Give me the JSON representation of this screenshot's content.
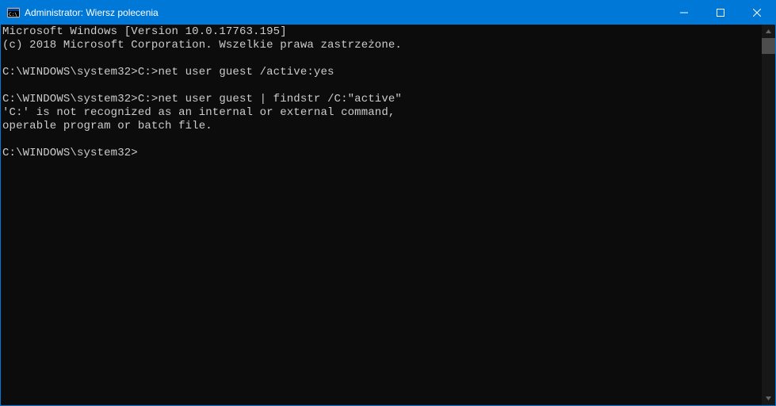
{
  "window": {
    "title": "Administrator: Wiersz polecenia"
  },
  "console": {
    "lines": [
      "Microsoft Windows [Version 10.0.17763.195]",
      "(c) 2018 Microsoft Corporation. Wszelkie prawa zastrzeżone.",
      "",
      "C:\\WINDOWS\\system32>C:>net user guest /active:yes",
      "",
      "C:\\WINDOWS\\system32>C:>net user guest | findstr /C:\"active\"",
      "'C:' is not recognized as an internal or external command,",
      "operable program or batch file.",
      "",
      "C:\\WINDOWS\\system32>"
    ]
  }
}
